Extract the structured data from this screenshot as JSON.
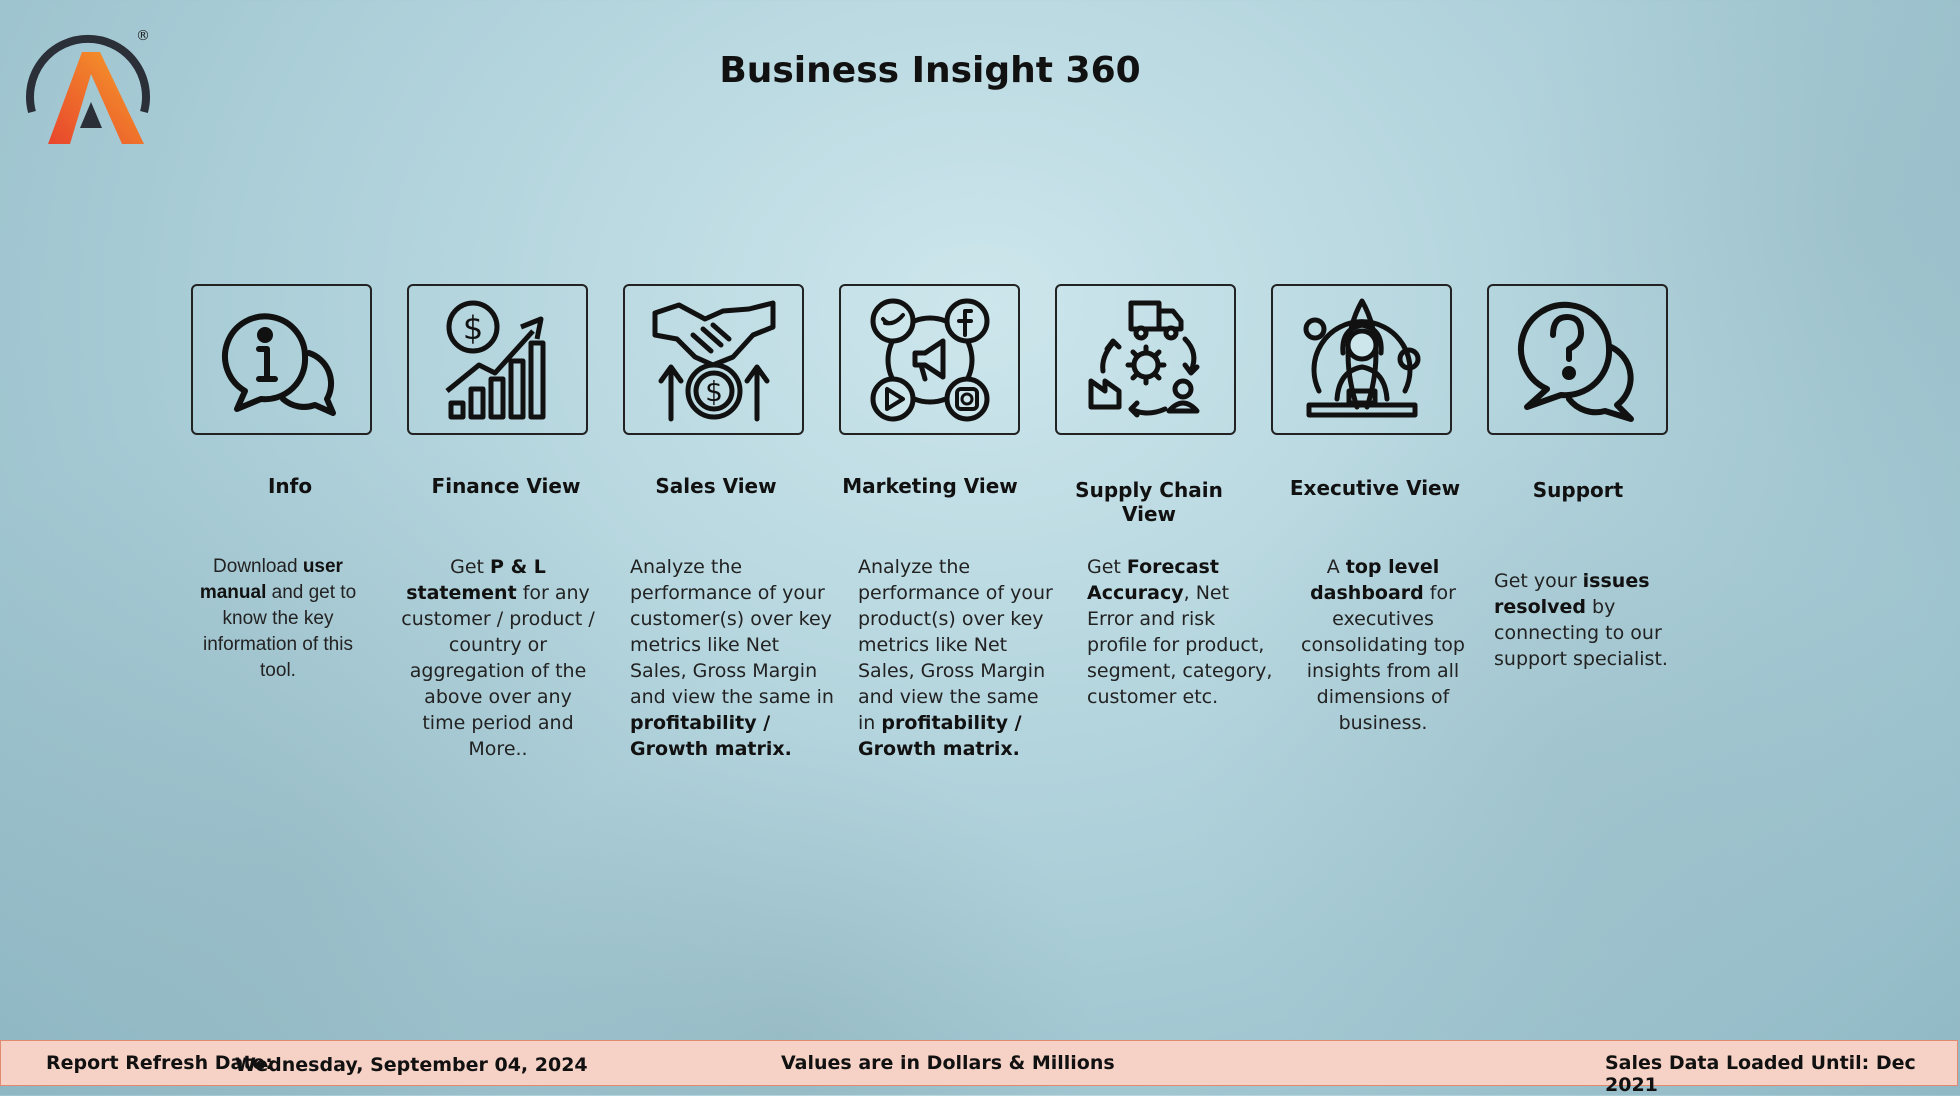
{
  "header": {
    "title": "Business Insight 360"
  },
  "logo": {
    "name": "brand-logo",
    "registered": "®",
    "colors": [
      "#e8452c",
      "#f08a2a",
      "#2a2f38"
    ]
  },
  "tiles": [
    {
      "label": "Info",
      "icon": "info-chat-icon",
      "desc": {
        "l1": "Download ",
        "b1": "user manual",
        "l2": " and get to know the key information of this tool."
      }
    },
    {
      "label": "Finance View",
      "icon": "finance-growth-icon",
      "desc": {
        "l1": "Get  ",
        "b1": "P & L statement",
        "l2": " for any customer / product / country or aggregation of the above over any time period and More.."
      }
    },
    {
      "label": "Sales View",
      "icon": "handshake-dollar-icon",
      "desc": {
        "l1": "Analyze the performance of your customer(s) over key metrics like Net Sales, Gross Margin and view the same in ",
        "b1": "profitability / Growth matrix.",
        "l2": ""
      }
    },
    {
      "label": "Marketing View",
      "icon": "social-media-icon",
      "desc": {
        "l1": "Analyze the performance of your product(s) over key metrics like Net Sales, Gross Margin and view the same in ",
        "b1": "profitability / Growth matrix.",
        "l2": ""
      }
    },
    {
      "label": "Supply Chain View",
      "icon": "supply-chain-icon",
      "desc": {
        "l1": "Get ",
        "b1": "Forecast Accuracy",
        "l2": ", Net Error and risk profile for product, segment, category, customer etc."
      }
    },
    {
      "label": "Executive View",
      "icon": "executive-globe-icon",
      "desc": {
        "l1": "A ",
        "b1": "top level dashboard",
        "l2": " for executives consolidating top insights from all dimensions of business."
      }
    },
    {
      "label": "Support",
      "icon": "support-question-icon",
      "desc": {
        "l1": "Get your ",
        "b1": "issues resolved",
        "l2": " by connecting to our support specialist."
      }
    }
  ],
  "footer": {
    "refresh_label": "Report Refresh Date:",
    "refresh_date": "Wednesday, September 04, 2024",
    "values_note": "Values are in Dollars & Millions",
    "loaded_label": "Sales Data Loaded Until: Dec 2021"
  }
}
